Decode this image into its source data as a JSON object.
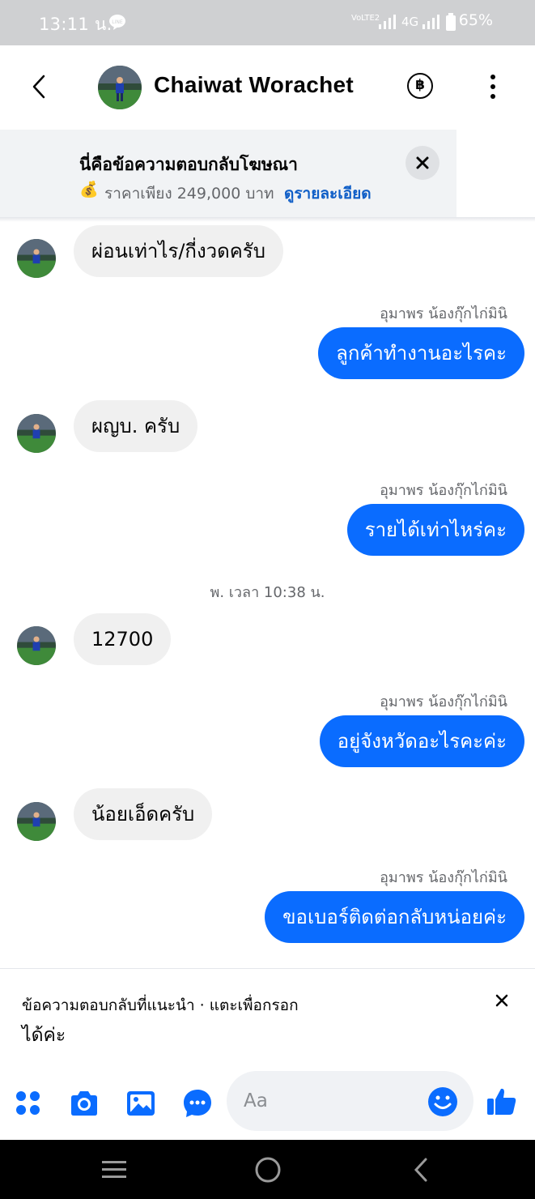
{
  "status_bar": {
    "time": "13:11 น.",
    "network": "4G",
    "volte": "VoLTE2",
    "battery_percent": "65%"
  },
  "header": {
    "contact_name": "Chaiwat Worachet",
    "baht_icon": "฿"
  },
  "ad_banner": {
    "title": "นี่คือข้อความตอบกลับโฆษณา",
    "money_icon": "💰",
    "price_text": "ราคาเพียง 249,000 บาท",
    "details_link": "ดูรายละเอียด"
  },
  "messages": [
    {
      "direction": "in",
      "text": "ผ่อนเท่าไร/กี่งวดครับ"
    },
    {
      "direction": "out",
      "sender": "อุมาพร น้องกุ๊กไก่มินิ",
      "text": "ลูกค้าทำงานอะไรคะ"
    },
    {
      "direction": "in",
      "text": "ผญบ. ครับ"
    },
    {
      "direction": "out",
      "sender": "อุมาพร น้องกุ๊กไก่มินิ",
      "text": "รายได้เท่าไหร่คะ"
    },
    {
      "direction": "in",
      "text": "12700"
    },
    {
      "direction": "out",
      "sender": "อุมาพร น้องกุ๊กไก่มินิ",
      "text": "อยู่จังหวัดอะไรคะค่ะ"
    },
    {
      "direction": "in",
      "text": "น้อยเอ็ดครับ"
    },
    {
      "direction": "out",
      "sender": "อุมาพร น้องกุ๊กไก่มินิ",
      "text": "ขอเบอร์ติดต่อกลับหน่อยค่ะ"
    }
  ],
  "timestamp": "พ. เวลา 10:38 น.",
  "suggestion": {
    "label": "ข้อความตอบกลับที่แนะนำ · แตะเพื่อกรอก",
    "text": "ได้ค่ะ"
  },
  "composer": {
    "placeholder": "Aa"
  },
  "colors": {
    "accent": "#0a6cff",
    "incoming_bubble": "#f0f0f0",
    "link": "#0f5ec7",
    "status_bar": "#cfd0d2"
  },
  "icons": [
    "back-arrow-icon",
    "baht-icon",
    "more-vertical-icon",
    "close-icon",
    "apps-icon",
    "camera-icon",
    "gallery-icon",
    "chat-bubble-icon",
    "emoji-icon",
    "like-icon",
    "nav-menu-icon",
    "nav-home-icon",
    "nav-back-icon"
  ]
}
